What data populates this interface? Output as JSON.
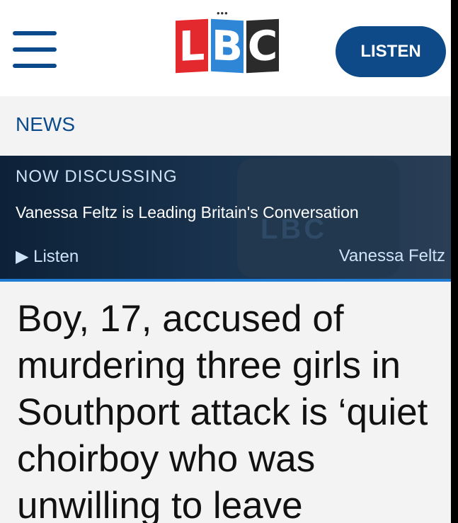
{
  "header": {
    "logo_text": "LBC",
    "logo_letters": [
      "L",
      "B",
      "C"
    ],
    "listen_label": "LISTEN"
  },
  "section": {
    "label": "NEWS"
  },
  "now_discussing": {
    "label": "NOW DISCUSSING",
    "show": "Vanessa Feltz is Leading Britain's Conversation",
    "listen_label": "▶ Listen",
    "host": "Vanessa Feltz"
  },
  "article": {
    "headline": "Boy, 17, accused of murdering three girls in Southport attack is ‘quiet choirboy who was unwilling to leave"
  },
  "colors": {
    "brand_blue": "#0e4a88",
    "logo_red": "#e3282e",
    "logo_blue": "#2f86d6",
    "logo_dark": "#2b2b2b",
    "band_dark": "#0d2238"
  }
}
